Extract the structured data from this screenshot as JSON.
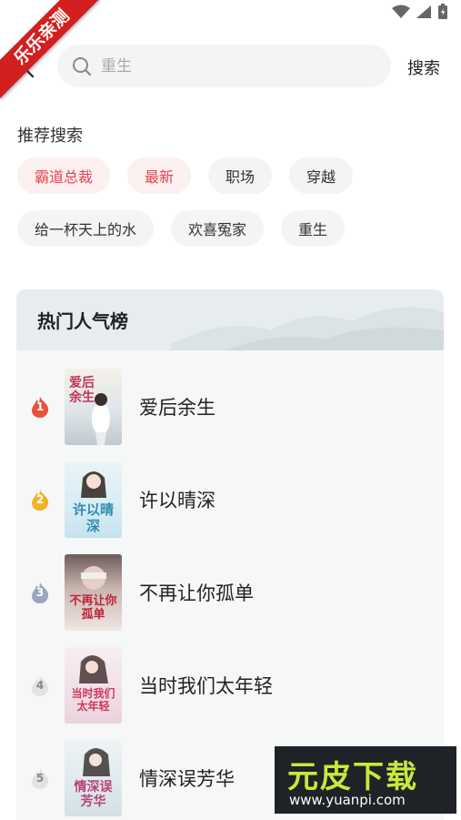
{
  "ribbon": "乐乐亲测",
  "search": {
    "placeholder": "重生",
    "button": "搜索"
  },
  "recommend": {
    "title": "推荐搜索",
    "chips": [
      "霸道总裁",
      "最新",
      "职场",
      "穿越",
      "给一杯天上的水",
      "欢喜冤家",
      "重生"
    ]
  },
  "hot": {
    "title": "热门人气榜",
    "items": [
      {
        "rank": "1",
        "title": "爱后余生",
        "cover_text": "爱后余生"
      },
      {
        "rank": "2",
        "title": "许以晴深",
        "cover_text": "许以晴深"
      },
      {
        "rank": "3",
        "title": "不再让你孤单",
        "cover_text": "不再让你孤单"
      },
      {
        "rank": "4",
        "title": "当时我们太年轻",
        "cover_text": "当时我们太年轻"
      },
      {
        "rank": "5",
        "title": "情深误芳华",
        "cover_text": "情深误芳华"
      }
    ]
  },
  "watermark": {
    "brand": "元皮下载",
    "url": "www.yuanpi.com"
  },
  "colors": {
    "accent_red": "#e0454f",
    "rank1": "#e8513e",
    "rank2": "#f0b429",
    "rank3": "#9aa6bd",
    "rank_other": "#cfcfcf"
  }
}
